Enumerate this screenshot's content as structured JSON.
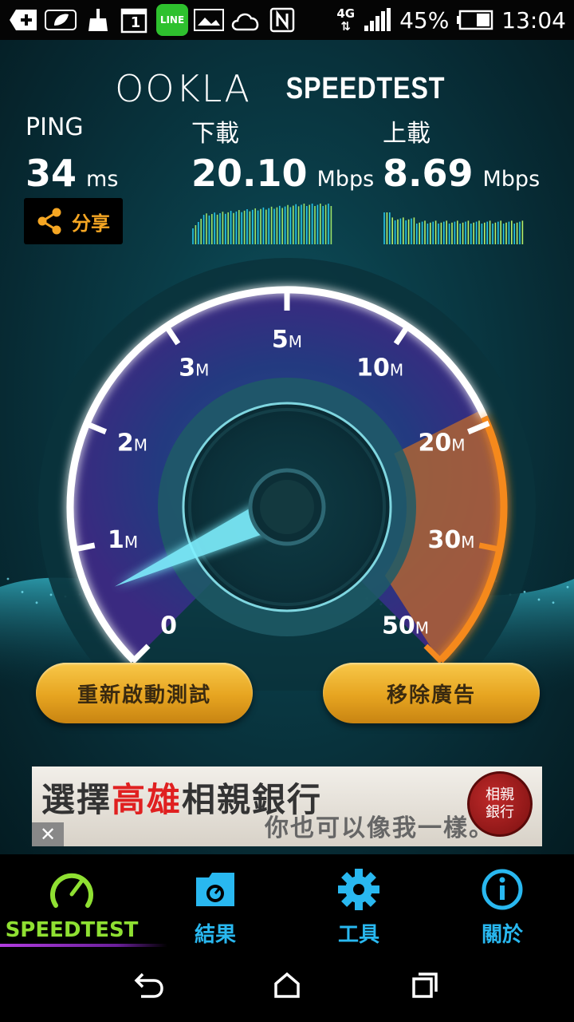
{
  "status_bar": {
    "battery_percent": "45%",
    "time": "13:04",
    "network": "4G",
    "calendar_day": "1",
    "line_app": "LINE"
  },
  "header": {
    "logo_ookla": "OOKLA",
    "logo_speedtest": "SPEEDTEST"
  },
  "stats": {
    "ping": {
      "label": "PING",
      "value": "34",
      "unit": "ms"
    },
    "download": {
      "label": "下載",
      "value": "20.10",
      "unit": "Mbps"
    },
    "upload": {
      "label": "上載",
      "value": "8.69",
      "unit": "Mbps"
    }
  },
  "share": {
    "label": "分享"
  },
  "gauge": {
    "ticks": [
      {
        "num": "0",
        "unit": ""
      },
      {
        "num": "1",
        "unit": "M"
      },
      {
        "num": "2",
        "unit": "M"
      },
      {
        "num": "3",
        "unit": "M"
      },
      {
        "num": "5",
        "unit": "M"
      },
      {
        "num": "10",
        "unit": "M"
      },
      {
        "num": "20",
        "unit": "M"
      },
      {
        "num": "30",
        "unit": "M"
      },
      {
        "num": "50",
        "unit": "M"
      }
    ],
    "needle_speed_mbps": 0.6,
    "colors": {
      "ring": "#ffffff",
      "glow": "#a780ff",
      "orange": "#f5891f",
      "needle": "#7ff0ff"
    }
  },
  "buttons": {
    "restart": "重新啟動測試",
    "remove_ads": "移除廣告"
  },
  "ad": {
    "headline_part1": "選擇",
    "headline_highlight": "高雄",
    "headline_part2": "相親銀行",
    "subline": "你也可以像我一樣。",
    "seal_line1": "相親",
    "seal_line2": "銀行",
    "close": "✕"
  },
  "tabs": [
    {
      "label": "SPEEDTEST",
      "icon": "speedometer-icon",
      "active": true
    },
    {
      "label": "結果",
      "icon": "results-folder-icon",
      "active": false
    },
    {
      "label": "工具",
      "icon": "gear-icon",
      "active": false
    },
    {
      "label": "關於",
      "icon": "info-icon",
      "active": false
    }
  ],
  "nav": {
    "back": "back-icon",
    "home": "home-icon",
    "recents": "recents-icon"
  }
}
